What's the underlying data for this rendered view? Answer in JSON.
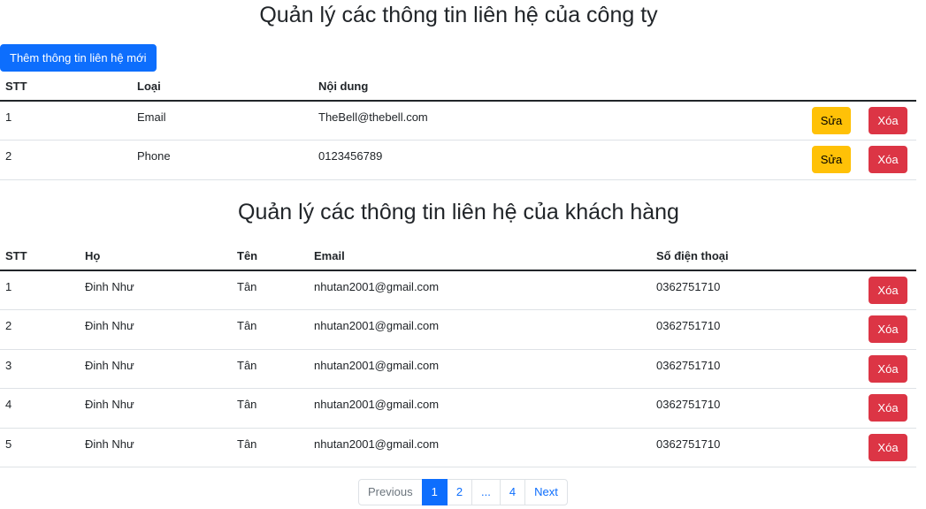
{
  "company": {
    "title": "Quản lý các thông tin liên hệ của công ty",
    "add_button": "Thêm thông tin liên hệ mới",
    "headers": [
      "STT",
      "Loại",
      "Nội dung"
    ],
    "rows": [
      {
        "stt": "1",
        "type": "Email",
        "content": "TheBell@thebell.com"
      },
      {
        "stt": "2",
        "type": "Phone",
        "content": "0123456789"
      }
    ],
    "edit_label": "Sửa",
    "delete_label": "Xóa"
  },
  "customers": {
    "title": "Quản lý các thông tin liên hệ của khách hàng",
    "headers": [
      "STT",
      "Họ",
      "Tên",
      "Email",
      "Số điện thoại"
    ],
    "rows": [
      {
        "stt": "1",
        "last": "Đinh Như",
        "first": "Tân",
        "email": "nhutan2001@gmail.com",
        "phone": "0362751710"
      },
      {
        "stt": "2",
        "last": "Đinh Như",
        "first": "Tân",
        "email": "nhutan2001@gmail.com",
        "phone": "0362751710"
      },
      {
        "stt": "3",
        "last": "Đinh Như",
        "first": "Tân",
        "email": "nhutan2001@gmail.com",
        "phone": "0362751710"
      },
      {
        "stt": "4",
        "last": "Đinh Như",
        "first": "Tân",
        "email": "nhutan2001@gmail.com",
        "phone": "0362751710"
      },
      {
        "stt": "5",
        "last": "Đinh Như",
        "first": "Tân",
        "email": "nhutan2001@gmail.com",
        "phone": "0362751710"
      }
    ],
    "delete_label": "Xóa"
  },
  "pagination": {
    "previous": "Previous",
    "pages": [
      "1",
      "2",
      "...",
      "4"
    ],
    "current": "1",
    "next": "Next"
  },
  "colors": {
    "primary": "#0d6efd",
    "warning": "#ffc107",
    "danger": "#dc3545"
  }
}
